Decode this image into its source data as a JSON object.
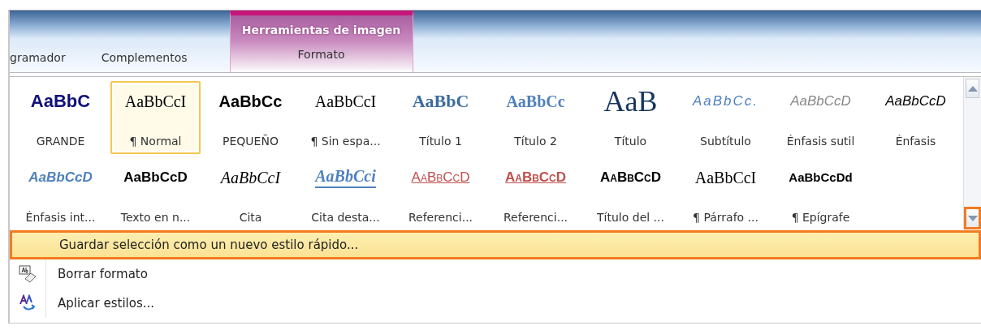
{
  "ribbon": {
    "tabs": [
      {
        "label": "gramador",
        "selected": false
      },
      {
        "label": "Complementos",
        "selected": false
      }
    ],
    "contextual_tab": {
      "group": "Herramientas de imagen",
      "label": "Formato",
      "selected": false
    }
  },
  "style_gallery": {
    "styles": [
      {
        "sample": "AaBbC",
        "label": "GRANDE",
        "kind": "grande",
        "selected": false
      },
      {
        "sample": "AaBbCcI",
        "label": "¶ Normal",
        "kind": "normal",
        "selected": true
      },
      {
        "sample": "AaBbCc",
        "label": "PEQUEÑO",
        "kind": "pequeno",
        "selected": false
      },
      {
        "sample": "AaBbCcI",
        "label": "¶ Sin espa...",
        "kind": "normal",
        "selected": false
      },
      {
        "sample": "AaBbC",
        "label": "Título 1",
        "kind": "titulo1",
        "selected": false
      },
      {
        "sample": "AaBbCc",
        "label": "Título 2",
        "kind": "titulo2",
        "selected": false
      },
      {
        "sample": "AaB",
        "label": "Título",
        "kind": "titulo",
        "selected": false
      },
      {
        "sample": "AaBbCc.",
        "label": "Subtítulo",
        "kind": "subtitulo",
        "selected": false
      },
      {
        "sample": "AaBbCcD",
        "label": "Énfasis sutil",
        "kind": "sutil",
        "selected": false
      },
      {
        "sample": "AaBbCcD",
        "label": "Énfasis",
        "kind": "enfasis",
        "selected": false
      },
      {
        "sample": "AaBbCcD",
        "label": "Énfasis int...",
        "kind": "intenso",
        "selected": false
      },
      {
        "sample": "AaBbCcD",
        "label": "Texto en n...",
        "kind": "negrita",
        "selected": false
      },
      {
        "sample": "AaBbCcI",
        "label": "Cita",
        "kind": "cita",
        "selected": false
      },
      {
        "sample": "AaBbCci",
        "label": "Cita desta...",
        "kind": "citadest",
        "selected": false
      },
      {
        "sample": "AaBbCcD",
        "label": "Referenci...",
        "kind": "refsutil",
        "selected": false
      },
      {
        "sample": "AaBbCcD",
        "label": "Referenci...",
        "kind": "refint",
        "selected": false
      },
      {
        "sample": "AaBbCcD",
        "label": "Título del ...",
        "kind": "titulolibro",
        "selected": false
      },
      {
        "sample": "AaBbCcI",
        "label": "¶ Párrafo ...",
        "kind": "normal",
        "selected": false
      },
      {
        "sample": "AaBbCcDd",
        "label": "¶ Epígrafe",
        "kind": "epigrafe",
        "selected": false
      }
    ],
    "scroll_down": {
      "highlighted": true
    }
  },
  "menu": [
    {
      "label": "Guardar selección como un nuevo estilo rápido...",
      "kind": "plain",
      "highlighted": true
    },
    {
      "label": "Borrar formato",
      "kind": "eraser",
      "highlighted": false
    },
    {
      "label": "Aplicar estilos...",
      "kind": "styles",
      "highlighted": false
    }
  ]
}
